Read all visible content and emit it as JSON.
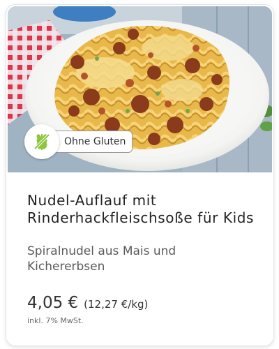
{
  "product": {
    "badge_label": "Ohne Gluten",
    "badge_icon": "wheat-crossed-icon",
    "title": "Nudel-Auflauf mit Rinderhackfleischsoße für Kids",
    "subtitle": "Spiralnudel aus Mais und Kichererbsen",
    "price": "4,05 €",
    "unit_price": "(12,27 €/kg)",
    "tax_note": "inkl. 7% MwSt."
  },
  "colors": {
    "badge_icon_green": "#8cc63f",
    "title_text": "#222222",
    "subtitle_text": "#5a5a5a"
  }
}
